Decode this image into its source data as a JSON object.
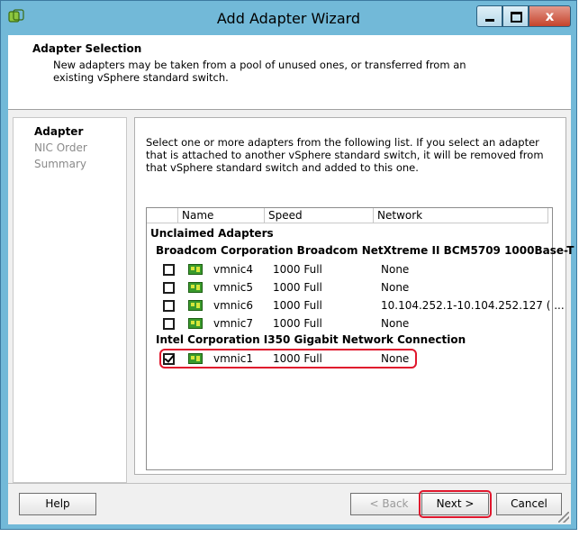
{
  "window": {
    "title": "Add Adapter Wizard",
    "close_glyph": "x"
  },
  "header": {
    "title": "Adapter Selection",
    "description": "New adapters may be taken from a pool of unused ones, or transferred from an existing vSphere standard switch."
  },
  "steps": [
    {
      "label": "Adapter",
      "active": true
    },
    {
      "label": "NIC Order",
      "active": false
    },
    {
      "label": "Summary",
      "active": false
    }
  ],
  "instructions": "Select one or more adapters from the following list. If you select an adapter that is attached to another vSphere standard switch, it will be removed from that vSphere standard switch and added to this one.",
  "table": {
    "columns": [
      "Name",
      "Speed",
      "Network"
    ],
    "section": "Unclaimed Adapters",
    "groups": [
      {
        "vendor": "Broadcom Corporation Broadcom NetXtreme II BCM5709 1000Base-T",
        "adapters": [
          {
            "name": "vmnic4",
            "speed": "1000 Full",
            "network": "None",
            "checked": false
          },
          {
            "name": "vmnic5",
            "speed": "1000 Full",
            "network": "None",
            "checked": false
          },
          {
            "name": "vmnic6",
            "speed": "1000 Full",
            "network": "10.104.252.1-10.104.252.127 ( ...",
            "checked": false
          },
          {
            "name": "vmnic7",
            "speed": "1000 Full",
            "network": "None",
            "checked": false
          }
        ]
      },
      {
        "vendor": "Intel Corporation I350 Gigabit Network Connection",
        "adapters": [
          {
            "name": "vmnic1",
            "speed": "1000 Full",
            "network": "None",
            "checked": true
          }
        ]
      }
    ]
  },
  "buttons": {
    "help": "Help",
    "back": "< Back",
    "next": "Next >",
    "cancel": "Cancel"
  },
  "colors": {
    "highlight": "#e0172d",
    "window_frame": "#72b9d8"
  }
}
